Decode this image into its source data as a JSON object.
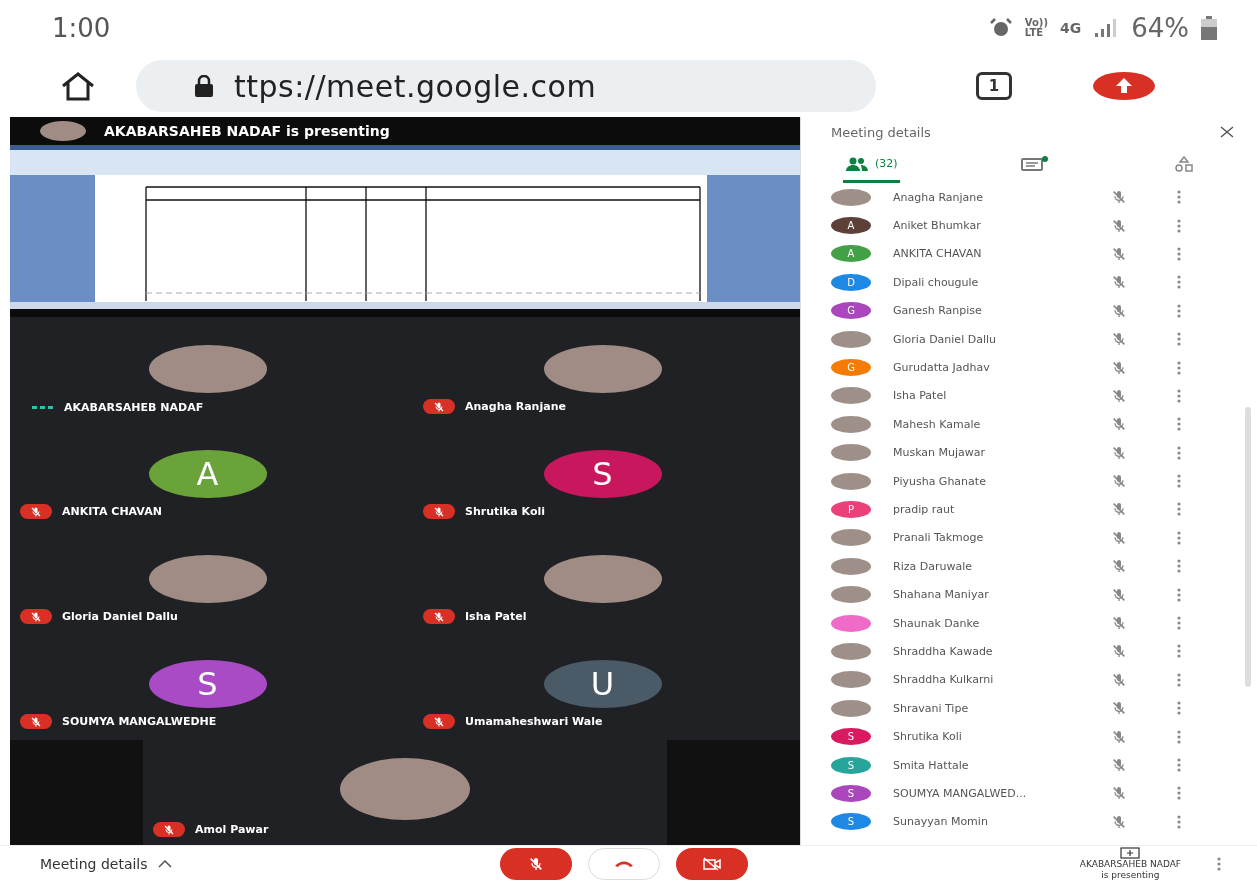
{
  "status_bar": {
    "time": "1:00",
    "volte_top": "Vo))",
    "volte_bottom": "LTE",
    "network": "4G",
    "battery": "64%"
  },
  "browser": {
    "url": "ttps://meet.google.com",
    "tab_count": "1"
  },
  "presentation": {
    "banner": "AKABARSAHEB NADAF is presenting"
  },
  "tiles": [
    {
      "name": "AKABARSAHEB NADAF",
      "kind": "photo",
      "muted": false
    },
    {
      "name": "Anagha Ranjane",
      "kind": "photo",
      "muted": true
    },
    {
      "name": "ANKITA CHAVAN",
      "kind": "letter",
      "initial": "A",
      "color": "#6aa33a",
      "muted": true
    },
    {
      "name": "Shrutika Koli",
      "kind": "letter",
      "initial": "S",
      "color": "#c8175d",
      "muted": true
    },
    {
      "name": "Gloria Daniel Dallu",
      "kind": "photo",
      "muted": true
    },
    {
      "name": "Isha Patel",
      "kind": "photo",
      "muted": true
    },
    {
      "name": "SOUMYA MANGALWEDHE",
      "kind": "letter",
      "initial": "S",
      "color": "#a94bc4",
      "muted": true
    },
    {
      "name": "Umamaheshwari Wale",
      "kind": "letter",
      "initial": "U",
      "color": "#4a5a66",
      "muted": true
    }
  ],
  "featured_tile": {
    "name": "Amol Pawar",
    "kind": "photo",
    "muted": true
  },
  "panel": {
    "title": "Meeting details",
    "tabs": [
      {
        "kind": "people",
        "label": "(32)",
        "selected": true
      },
      {
        "kind": "chat",
        "selected": false
      },
      {
        "kind": "activities",
        "selected": false
      }
    ],
    "participants": [
      {
        "name": "Anagha Ranjane",
        "kind": "photo",
        "muted": true
      },
      {
        "name": "Aniket Bhumkar",
        "kind": "letter",
        "initial": "A",
        "color": "#5d4037",
        "muted": true
      },
      {
        "name": "ANKITA CHAVAN",
        "kind": "letter",
        "initial": "A",
        "color": "#43a047",
        "muted": true
      },
      {
        "name": "Dipali chougule",
        "kind": "letter",
        "initial": "D",
        "color": "#1e88e5",
        "muted": true
      },
      {
        "name": "Ganesh Ranpise",
        "kind": "letter",
        "initial": "G",
        "color": "#ab47bc",
        "muted": true
      },
      {
        "name": "Gloria Daniel Dallu",
        "kind": "photo",
        "muted": true
      },
      {
        "name": "Gurudatta Jadhav",
        "kind": "letter",
        "initial": "G",
        "color": "#f57c00",
        "muted": true
      },
      {
        "name": "Isha Patel",
        "kind": "photo",
        "muted": true
      },
      {
        "name": "Mahesh Kamale",
        "kind": "photo",
        "muted": true
      },
      {
        "name": "Muskan Mujawar",
        "kind": "photo",
        "muted": true
      },
      {
        "name": "Piyusha Ghanate",
        "kind": "photo",
        "muted": true
      },
      {
        "name": "pradip raut",
        "kind": "letter",
        "initial": "P",
        "color": "#ec407a",
        "muted": true
      },
      {
        "name": "Pranali Takmoge",
        "kind": "photo",
        "muted": true
      },
      {
        "name": "Riza Daruwale",
        "kind": "photo",
        "muted": true
      },
      {
        "name": "Shahana Maniyar",
        "kind": "photo",
        "muted": true
      },
      {
        "name": "Shaunak Danke",
        "kind": "letter",
        "color": "#f06ac8",
        "muted": true
      },
      {
        "name": "Shraddha Kawade",
        "kind": "photo",
        "muted": true
      },
      {
        "name": "Shraddha Kulkarni",
        "kind": "photo",
        "muted": true
      },
      {
        "name": "Shravani Tipe",
        "kind": "photo",
        "muted": true
      },
      {
        "name": "Shrutika Koli",
        "kind": "letter",
        "initial": "S",
        "color": "#d81b60",
        "muted": true
      },
      {
        "name": "Smita Hattale",
        "kind": "letter",
        "initial": "S",
        "color": "#26a69a",
        "muted": true
      },
      {
        "name": "SOUMYA MANGALWED...",
        "kind": "letter",
        "initial": "S",
        "color": "#ab47bc",
        "muted": true
      },
      {
        "name": "Sunayyan Momin",
        "kind": "letter",
        "initial": "S",
        "color": "#1e88e5",
        "muted": true
      }
    ]
  },
  "bottom_bar": {
    "details_label": "Meeting details",
    "presenter_name": "AKABARSAHEB NADAF",
    "presenter_status": "is presenting"
  }
}
